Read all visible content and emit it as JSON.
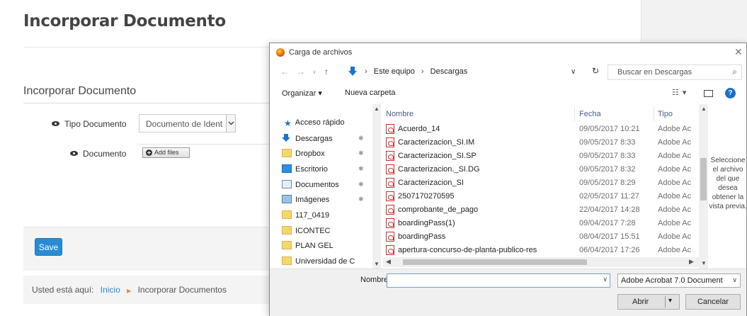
{
  "page": {
    "title": "Incorporar Documento",
    "section_title": "Incorporar Documento",
    "tipo_label": "Tipo Documento",
    "tipo_value": "Documento de Ident",
    "documento_label": "Documento",
    "add_files_label": "Add files",
    "save_label": "Save",
    "breadcrumb": {
      "prefix": "Usted está aquí:",
      "home": "Inicio",
      "current": "Incorporar Documentos"
    }
  },
  "dialog": {
    "title": "Carga de archivos",
    "path": [
      "Este equipo",
      "Descargas"
    ],
    "search_placeholder": "Buscar en Descargas",
    "organize_label": "Organizar ▾",
    "new_folder_label": "Nueva carpeta",
    "nav_items": [
      {
        "label": "Acceso rápido",
        "icon": "star-icon"
      },
      {
        "label": "Descargas",
        "icon": "download-icon"
      },
      {
        "label": "Dropbox",
        "icon": "dropbox-icon"
      },
      {
        "label": "Escritorio",
        "icon": "desktop-icon"
      },
      {
        "label": "Documentos",
        "icon": "documents-icon"
      },
      {
        "label": "Imágenes",
        "icon": "images-icon"
      },
      {
        "label": "117_0419",
        "icon": "folder-icon"
      },
      {
        "label": "ICONTEC",
        "icon": "folder-icon"
      },
      {
        "label": "PLAN GEL",
        "icon": "folder-icon"
      },
      {
        "label": "Universidad de C",
        "icon": "folder-icon"
      }
    ],
    "columns": {
      "name": "Nombre",
      "date": "Fecha",
      "type": "Tipo"
    },
    "files": [
      {
        "name": "Acuerdo_14",
        "date": "09/05/2017 10:21",
        "type": "Adobe Ac"
      },
      {
        "name": "Caracterizacion_SI.IM",
        "date": "09/05/2017 8:33",
        "type": "Adobe Ac"
      },
      {
        "name": "Caracterizacion_SI.SP",
        "date": "09/05/2017 8:33",
        "type": "Adobe Ac"
      },
      {
        "name": "Caracterizacion._SI.DG",
        "date": "09/05/2017 8:32",
        "type": "Adobe Ac"
      },
      {
        "name": "Caracterizacion_SI",
        "date": "09/05/2017 8:29",
        "type": "Adobe Ac"
      },
      {
        "name": "2507170270595",
        "date": "02/05/2017 11:27",
        "type": "Adobe Ac"
      },
      {
        "name": "comprobante_de_pago",
        "date": "22/04/2017 14:28",
        "type": "Adobe Ac"
      },
      {
        "name": "boardingPass(1)",
        "date": "09/04/2017 7:28",
        "type": "Adobe Ac"
      },
      {
        "name": "boardingPass",
        "date": "08/04/2017 15:51",
        "type": "Adobe Ac"
      },
      {
        "name": "apertura-concurso-de-planta-publico-res",
        "date": "06/04/2017 17:26",
        "type": "Adobe Ac"
      }
    ],
    "preview_message": "Seleccione el archivo del que desea obtener la vista previa.",
    "filename_label": "Nombre:",
    "filename_value": "",
    "filetype_value": "Adobe Acrobat 7.0 Document",
    "open_label": "Abrir",
    "cancel_label": "Cancelar"
  }
}
